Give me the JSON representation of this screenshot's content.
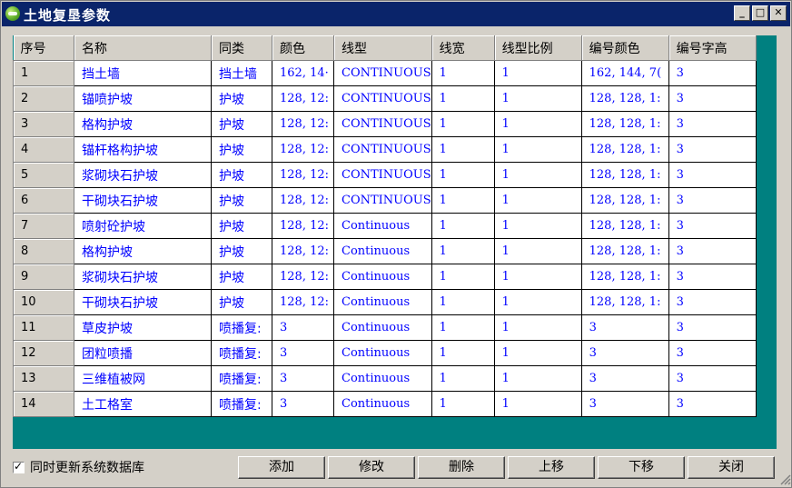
{
  "window": {
    "title": "土地复垦参数"
  },
  "columns": [
    "序号",
    "名称",
    "同类",
    "颜色",
    "线型",
    "线宽",
    "线型比例",
    "编号颜色",
    "编号字高"
  ],
  "rows": [
    [
      "1",
      "挡土墙",
      "挡土墙",
      "162, 14·",
      "CONTINUOUS",
      "1",
      "1",
      "162, 144, 7(",
      "3"
    ],
    [
      "2",
      "锚喷护坡",
      "护坡",
      "128, 12:",
      "CONTINUOUS",
      "1",
      "1",
      "128, 128, 1:",
      "3"
    ],
    [
      "3",
      "格构护坡",
      "护坡",
      "128, 12:",
      "CONTINUOUS",
      "1",
      "1",
      "128, 128, 1:",
      "3"
    ],
    [
      "4",
      "锚杆格构护坡",
      "护坡",
      "128, 12:",
      "CONTINUOUS",
      "1",
      "1",
      "128, 128, 1:",
      "3"
    ],
    [
      "5",
      "浆砌块石护坡",
      "护坡",
      "128, 12:",
      "CONTINUOUS",
      "1",
      "1",
      "128, 128, 1:",
      "3"
    ],
    [
      "6",
      "干砌块石护坡",
      "护坡",
      "128, 12:",
      "CONTINUOUS",
      "1",
      "1",
      "128, 128, 1:",
      "3"
    ],
    [
      "7",
      "喷射砼护坡",
      "护坡",
      "128, 12:",
      "Continuous",
      "1",
      "1",
      "128, 128, 1:",
      "3"
    ],
    [
      "8",
      "格构护坡",
      "护坡",
      "128, 12:",
      "Continuous",
      "1",
      "1",
      "128, 128, 1:",
      "3"
    ],
    [
      "9",
      "浆砌块石护坡",
      "护坡",
      "128, 12:",
      "Continuous",
      "1",
      "1",
      "128, 128, 1:",
      "3"
    ],
    [
      "10",
      "干砌块石护坡",
      "护坡",
      "128, 12:",
      "Continuous",
      "1",
      "1",
      "128, 128, 1:",
      "3"
    ],
    [
      "11",
      "草皮护坡",
      "喷播复:",
      "3",
      "Continuous",
      "1",
      "1",
      "3",
      "3"
    ],
    [
      "12",
      "团粒喷播",
      "喷播复:",
      "3",
      "Continuous",
      "1",
      "1",
      "3",
      "3"
    ],
    [
      "13",
      "三维植被网",
      "喷播复:",
      "3",
      "Continuous",
      "1",
      "1",
      "3",
      "3"
    ],
    [
      "14",
      "土工格室",
      "喷播复:",
      "3",
      "Continuous",
      "1",
      "1",
      "3",
      "3"
    ]
  ],
  "footer": {
    "checkbox_label": "同时更新系统数据库",
    "checkbox_checked": true,
    "buttons": [
      "添加",
      "修改",
      "删除",
      "上移",
      "下移",
      "关闭"
    ]
  },
  "colors": {
    "title_bar": "#0a246a",
    "grid_bg": "#008080",
    "cell_text": "#0000ff"
  }
}
